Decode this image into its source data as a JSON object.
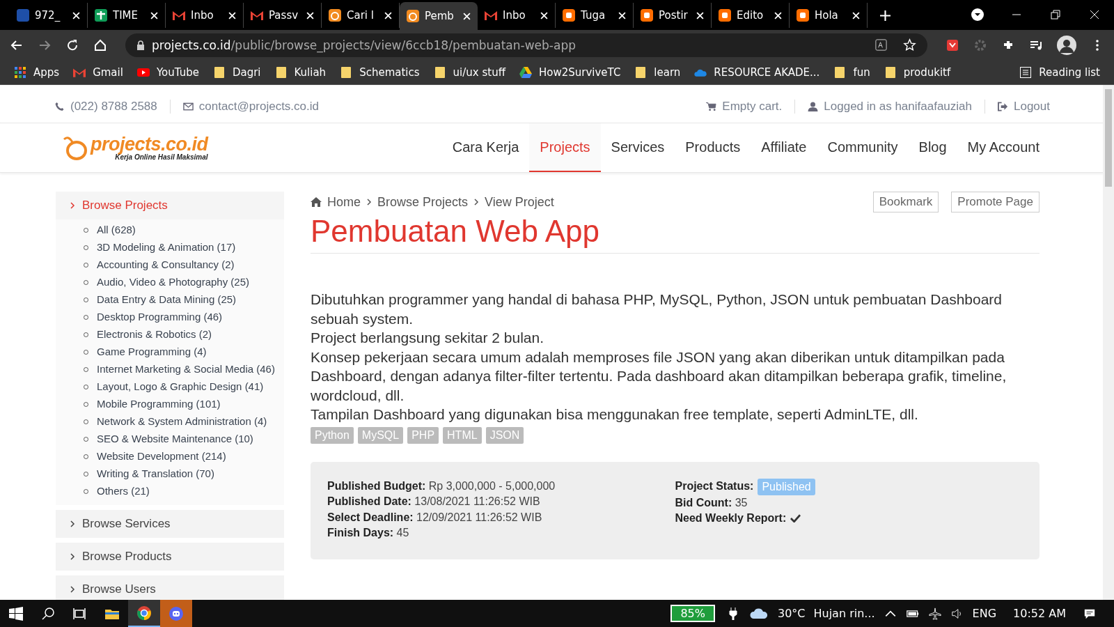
{
  "browser": {
    "tabs": [
      {
        "title": "972_",
        "kind": "campus",
        "selected": false
      },
      {
        "title": "TIME",
        "kind": "sheet",
        "selected": false
      },
      {
        "title": "Inbo",
        "kind": "mail",
        "selected": false
      },
      {
        "title": "Passv",
        "kind": "mail",
        "selected": false
      },
      {
        "title": "Cari l",
        "kind": "site",
        "selected": false
      },
      {
        "title": "Pemb",
        "kind": "site",
        "selected": true
      },
      {
        "title": "Inbo",
        "kind": "mail",
        "selected": false
      },
      {
        "title": "Tuga",
        "kind": "blog",
        "selected": false
      },
      {
        "title": "Postir",
        "kind": "blog",
        "selected": false
      },
      {
        "title": "Edito",
        "kind": "blog",
        "selected": false
      },
      {
        "title": "Hola",
        "kind": "blog",
        "selected": false
      }
    ],
    "address": {
      "domain": "projects.co.id",
      "path": "/public/browse_projects/view/6ccb18/pembuatan-web-app"
    },
    "bookmarks": [
      {
        "label": "Apps",
        "kind": "apps"
      },
      {
        "label": "Gmail",
        "kind": "gmail"
      },
      {
        "label": "YouTube",
        "kind": "youtube"
      },
      {
        "label": "Dagri",
        "kind": "folder"
      },
      {
        "label": "Kuliah",
        "kind": "folder"
      },
      {
        "label": "Schematics",
        "kind": "folder"
      },
      {
        "label": "ui/ux stuff",
        "kind": "folder"
      },
      {
        "label": "How2SurviveTC",
        "kind": "drive"
      },
      {
        "label": "learn",
        "kind": "folder"
      },
      {
        "label": "RESOURCE AKADE...",
        "kind": "cloud"
      },
      {
        "label": "fun",
        "kind": "folder"
      },
      {
        "label": "produkitf",
        "kind": "folder"
      }
    ],
    "reading_list": "Reading list"
  },
  "topbar": {
    "phone": "(022) 8788 2588",
    "email": "contact@projects.co.id",
    "cart": "Empty cart.",
    "user": "Logged in as hanifaafauziah",
    "logout": "Logout"
  },
  "logo": {
    "name": "projects.co.id",
    "tagline": "Kerja Online Hasil Maksimal"
  },
  "nav": [
    {
      "label": "Cara Kerja",
      "selected": false
    },
    {
      "label": "Projects",
      "selected": true
    },
    {
      "label": "Services",
      "selected": false
    },
    {
      "label": "Products",
      "selected": false
    },
    {
      "label": "Affiliate",
      "selected": false
    },
    {
      "label": "Community",
      "selected": false
    },
    {
      "label": "Blog",
      "selected": false
    },
    {
      "label": "My Account",
      "selected": false
    }
  ],
  "sidebar": [
    {
      "label": "Browse Projects",
      "expanded": true,
      "children": [
        "All (628)",
        "3D Modeling & Animation (17)",
        "Accounting & Consultancy (2)",
        "Audio, Video & Photography (25)",
        "Data Entry & Data Mining (25)",
        "Desktop Programming (46)",
        "Electronis & Robotics (2)",
        "Game Programming (4)",
        "Internet Marketing & Social Media (46)",
        "Layout, Logo & Graphic Design (41)",
        "Mobile Programming (101)",
        "Network & System Administration (4)",
        "SEO & Website Maintenance (10)",
        "Website Development (214)",
        "Writing & Translation (70)",
        "Others (21)"
      ]
    },
    {
      "label": "Browse Services",
      "expanded": false
    },
    {
      "label": "Browse Products",
      "expanded": false
    },
    {
      "label": "Browse Users",
      "expanded": false
    }
  ],
  "breadcrumb": [
    "Home",
    "Browse Projects",
    "View Project"
  ],
  "actions": [
    "Bookmark",
    "Promote Page"
  ],
  "title": "Pembuatan Web App",
  "description": [
    "Dibutuhkan programmer yang handal di bahasa PHP, MySQL, Python, JSON untuk pembuatan Dashboard sebuah system.",
    "Project berlangsung sekitar 2 bulan.",
    "Konsep pekerjaan secara umum adalah memproses file JSON yang akan diberikan untuk ditampilkan pada Dashboard, dengan adanya filter-filter tertentu. Pada dashboard akan ditampilkan beberapa grafik, timeline, wordcloud, dll.",
    "Tampilan Dashboard yang digunakan bisa menggunakan free  template, seperti AdminLTE, dll."
  ],
  "tags": [
    "Python",
    "MySQL",
    "PHP",
    "HTML",
    "JSON"
  ],
  "details": {
    "left": [
      {
        "label": "Published Budget:",
        "value": "Rp 3,000,000 - 5,000,000"
      },
      {
        "label": "Published Date:",
        "value": "13/08/2021 11:26:52 WIB"
      },
      {
        "label": "Select Deadline:",
        "value": "12/09/2021 11:26:52 WIB"
      },
      {
        "label": "Finish Days:",
        "value": "45"
      }
    ],
    "status_label": "Project Status:",
    "status": "Published",
    "bid_label": "Bid Count:",
    "bid_count": "35",
    "weekly_label": "Need Weekly Report:",
    "weekly_report": true
  },
  "taskbar": {
    "battery": "85%",
    "weather": "30°C",
    "weather_text": "Hujan rin...",
    "language": "ENG",
    "time": "10:52 AM"
  }
}
